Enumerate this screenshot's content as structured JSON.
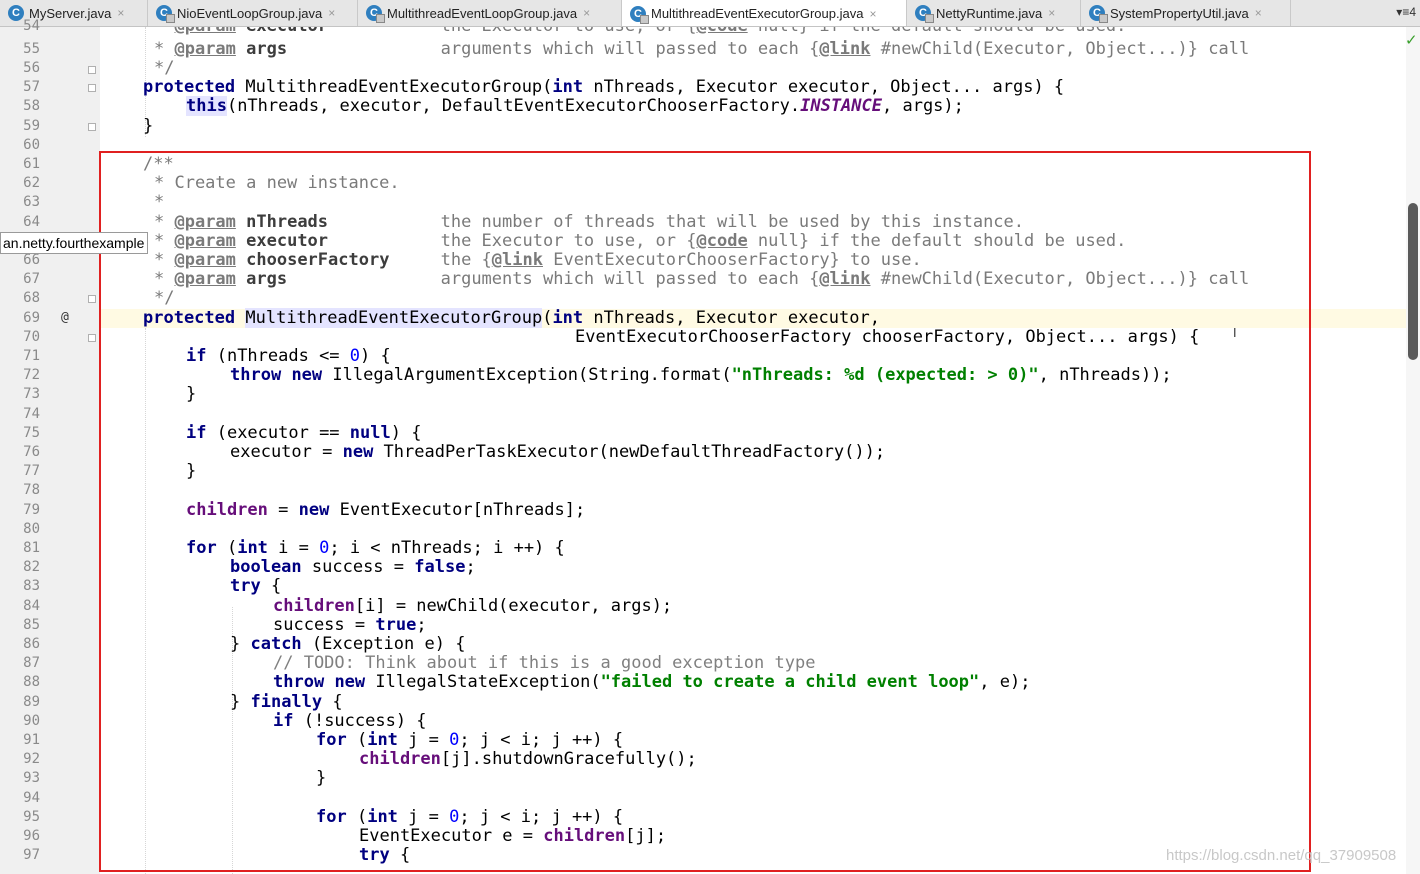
{
  "tabs": [
    {
      "label": "MyServer.java",
      "active": false
    },
    {
      "label": "NioEventLoopGroup.java",
      "active": false
    },
    {
      "label": "MultithreadEventLoopGroup.java",
      "active": false
    },
    {
      "label": "MultithreadEventExecutorGroup.java",
      "active": true
    },
    {
      "label": "NettyRuntime.java",
      "active": false
    },
    {
      "label": "SystemPropertyUtil.java",
      "active": false
    }
  ],
  "tab_icon_glyph": "C",
  "tab_close_glyph": "×",
  "tab_menu_label": "▾≡4",
  "line_numbers": [
    "54",
    "55",
    "56",
    "57",
    "58",
    "59",
    "60",
    "61",
    "62",
    "63",
    "64",
    "65",
    "66",
    "67",
    "68",
    "69",
    "70",
    "71",
    "72",
    "73",
    "74",
    "75",
    "76",
    "77",
    "78",
    "79",
    "80",
    "81",
    "82",
    "83",
    "84",
    "85",
    "86",
    "87",
    "88",
    "89",
    "90",
    "91",
    "92",
    "93",
    "94",
    "95",
    "96",
    "97"
  ],
  "override_marker": "@",
  "tooltip_text": "an.netty.fourthexample",
  "watermark": "https://blog.csdn.net/qq_37909508",
  "check_glyph": "✓",
  "cursor_glyph": "I",
  "colors": {
    "keyword": "#000080",
    "string": "#008000",
    "number": "#0000ff",
    "field": "#660e7a",
    "highlight_box": "#e02020"
  },
  "code": {
    "l54": [
      "* ",
      "@param",
      " executor",
      "           the Executor to use, or {",
      "@code",
      " null} if the default should be used."
    ],
    "l55": [
      "* ",
      "@param",
      " args",
      "               arguments which will passed to each {",
      "@link",
      " #newChild(Executor, Object...)} call"
    ],
    "l56": "*/",
    "l57": [
      "protected",
      " MultithreadEventExecutorGroup(",
      "int",
      " nThreads, Executor executor, Object... args) {"
    ],
    "l58": [
      "this",
      "(nThreads, executor, DefaultEventExecutorChooserFactory.",
      "INSTANCE",
      ", args);"
    ],
    "l59": "}",
    "l61": "/**",
    "l62": "* Create a new instance.",
    "l63": "*",
    "l64": [
      "* ",
      "@param",
      " nThreads",
      "           the number of threads that will be used by this instance."
    ],
    "l65": [
      "* ",
      "@param",
      " executor",
      "           the Executor to use, or {",
      "@code",
      " null} if the default should be used."
    ],
    "l66": [
      "* ",
      "@param",
      " chooserFactory",
      "     the {",
      "@link",
      " EventExecutorChooserFactory} to use."
    ],
    "l67": [
      "* ",
      "@param",
      " args",
      "               arguments which will passed to each {",
      "@link",
      " #newChild(Executor, Object...)} call"
    ],
    "l68": "*/",
    "l69": [
      "protected",
      " ",
      "MultithreadEventExecutorGroup",
      "(",
      "int",
      " nThreads, Executor executor,"
    ],
    "l70": "EventExecutorChooserFactory chooserFactory, Object... args) {",
    "l71": [
      "if",
      " (nThreads <= ",
      "0",
      ") {"
    ],
    "l72": [
      "throw",
      " ",
      "new",
      " IllegalArgumentException(String.format(",
      "\"nThreads: %d (expected: > 0)\"",
      ", nThreads));"
    ],
    "l73": "}",
    "l75": [
      "if",
      " (executor == ",
      "null",
      ") {"
    ],
    "l76": [
      "executor = ",
      "new",
      " ThreadPerTaskExecutor(newDefaultThreadFactory());"
    ],
    "l77": "}",
    "l79": [
      "children",
      " = ",
      "new",
      " EventExecutor[nThreads];"
    ],
    "l81": [
      "for",
      " (",
      "int",
      " i = ",
      "0",
      "; i < nThreads; i ++) {"
    ],
    "l82": [
      "boolean",
      " success = ",
      "false",
      ";"
    ],
    "l83": [
      "try",
      " {"
    ],
    "l84": [
      "children",
      "[i] = newChild(executor, args);"
    ],
    "l85": [
      "success = ",
      "true",
      ";"
    ],
    "l86": [
      "} ",
      "catch",
      " (Exception e) {"
    ],
    "l87": "// TODO: Think about if this is a good exception type",
    "l88": [
      "throw",
      " ",
      "new",
      " IllegalStateException(",
      "\"failed to create a child event loop\"",
      ", e);"
    ],
    "l89": [
      "} ",
      "finally",
      " {"
    ],
    "l90": [
      "if",
      " (!success) {"
    ],
    "l91": [
      "for",
      " (",
      "int",
      " j = ",
      "0",
      "; j < i; j ++) {"
    ],
    "l92": [
      "children",
      "[j].shutdownGracefully();"
    ],
    "l93": "}",
    "l95": [
      "for",
      " (",
      "int",
      " j = ",
      "0",
      "; j < i; j ++) {"
    ],
    "l96": [
      "EventExecutor e = ",
      "children",
      "[j];"
    ],
    "l97": [
      "try",
      " {"
    ]
  }
}
